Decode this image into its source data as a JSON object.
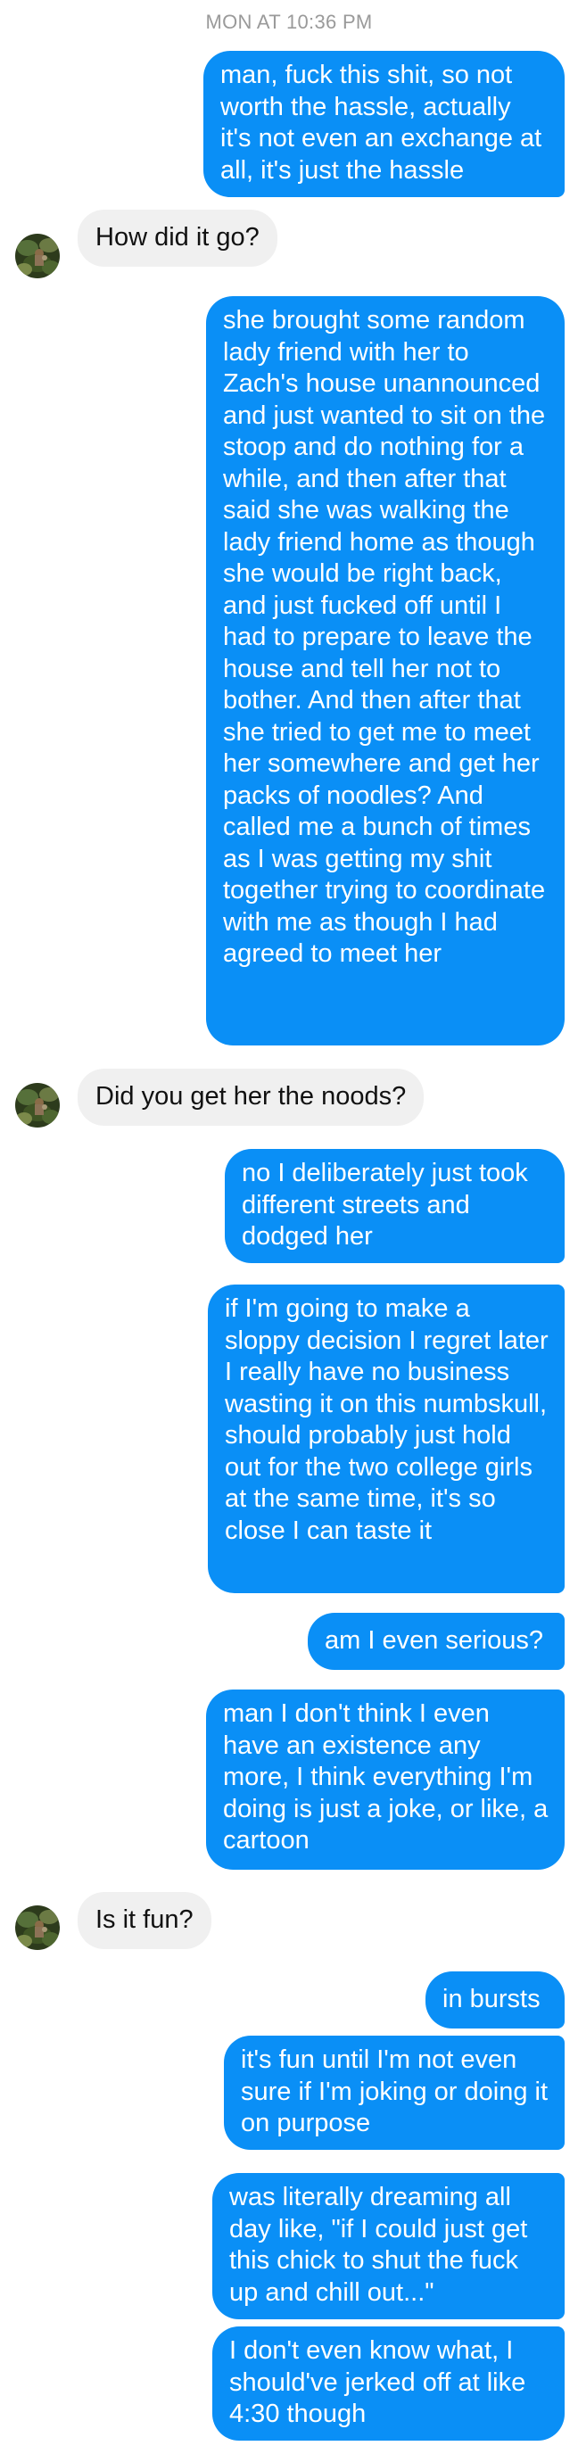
{
  "conversation": {
    "timestamp": "MON AT 10:36 PM",
    "messages": [
      {
        "sender": "me",
        "text": "man, fuck this shit, so not worth the hassle, actually it's not even an exchange at all, it's just the hassle"
      },
      {
        "sender": "them",
        "text": "How did it go?"
      },
      {
        "sender": "me",
        "text": "she brought some random lady friend with her to Zach's house unannounced and just wanted to sit on the stoop and do nothing for a while, and then after that said she was walking the lady friend home as though she would be right back, and just fucked off until I had to prepare to leave the house and tell her not to bother. And then after that she tried to get me to meet her somewhere and get her packs of noodles? And called me a bunch of times as I was getting my shit together trying to coordinate with me as though I had agreed to meet her"
      },
      {
        "sender": "them",
        "text": "Did you get her the noods?"
      },
      {
        "sender": "me",
        "text": "no I deliberately just took different streets and dodged her"
      },
      {
        "sender": "me",
        "text": "if I'm going to make a sloppy decision I regret later I really have no business wasting it on this numbskull, should probably just hold out for the two college girls at the same time, it's so close I can taste it"
      },
      {
        "sender": "me",
        "text": "am I even serious?"
      },
      {
        "sender": "me",
        "text": "man I don't think I even have an existence any more, I think everything I'm doing is just a joke, or like, a cartoon"
      },
      {
        "sender": "them",
        "text": "Is it fun?"
      },
      {
        "sender": "me",
        "text": "in bursts"
      },
      {
        "sender": "me",
        "text": "it's fun until I'm not even sure if I'm joking or doing it on purpose"
      },
      {
        "sender": "me",
        "text": "was literally dreaming all day like, \"if I could just get this chick to shut the fuck up and chill out...\""
      },
      {
        "sender": "me",
        "text": "I don't even know what, I should've jerked off at like 4:30 though"
      }
    ]
  },
  "colors": {
    "outgoing_bubble": "#0a8ff6",
    "incoming_bubble": "#f0f0f0",
    "timestamp_text": "#9a9a9a"
  },
  "icons": {
    "contact_avatar": "avatar-icon"
  }
}
